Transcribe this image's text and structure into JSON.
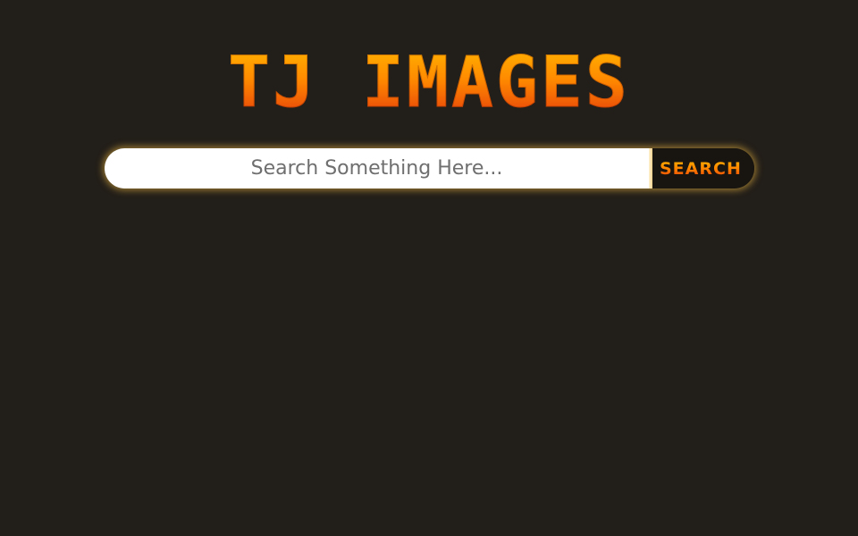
{
  "header": {
    "title": "TJ IMAGES"
  },
  "search": {
    "placeholder": "Search Something Here...",
    "value": "",
    "button_label": "SEARCH"
  },
  "colors": {
    "background": "#221e19",
    "accent_top": "#ffb300",
    "accent_bottom": "#e43c0a",
    "glow": "#ffc446"
  }
}
